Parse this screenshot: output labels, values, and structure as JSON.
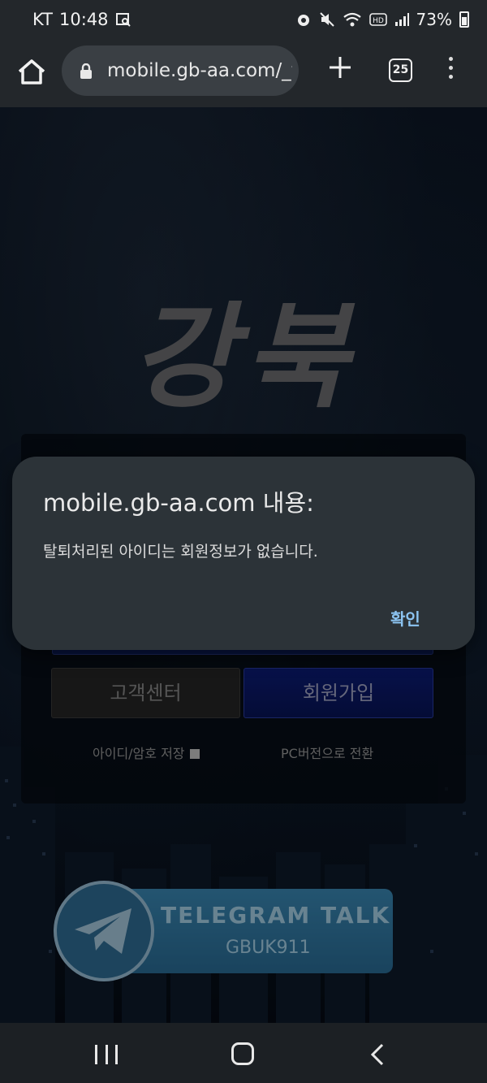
{
  "status_bar": {
    "carrier": "KT",
    "time": "10:48",
    "battery_percent": "73%"
  },
  "browser": {
    "url": "mobile.gb-aa.com/_v",
    "tab_count": "25"
  },
  "page": {
    "logo_text": "강북",
    "customer_center_label": "고객센터",
    "join_label": "회원가입",
    "save_id_label": "아이디/암호 저장",
    "pc_version_label": "PC버전으로 전환",
    "telegram_title": "TELEGRAM TALK",
    "telegram_id": "GBUK911"
  },
  "dialog": {
    "title": "mobile.gb-aa.com 내용:",
    "message": "탈퇴처리된 아이디는 회원정보가 없습니다.",
    "ok_label": "확인"
  },
  "colors": {
    "accent_link": "#8cc4f2",
    "join_button": "#0c1c78",
    "telegram_blue": "#3a89b6"
  }
}
